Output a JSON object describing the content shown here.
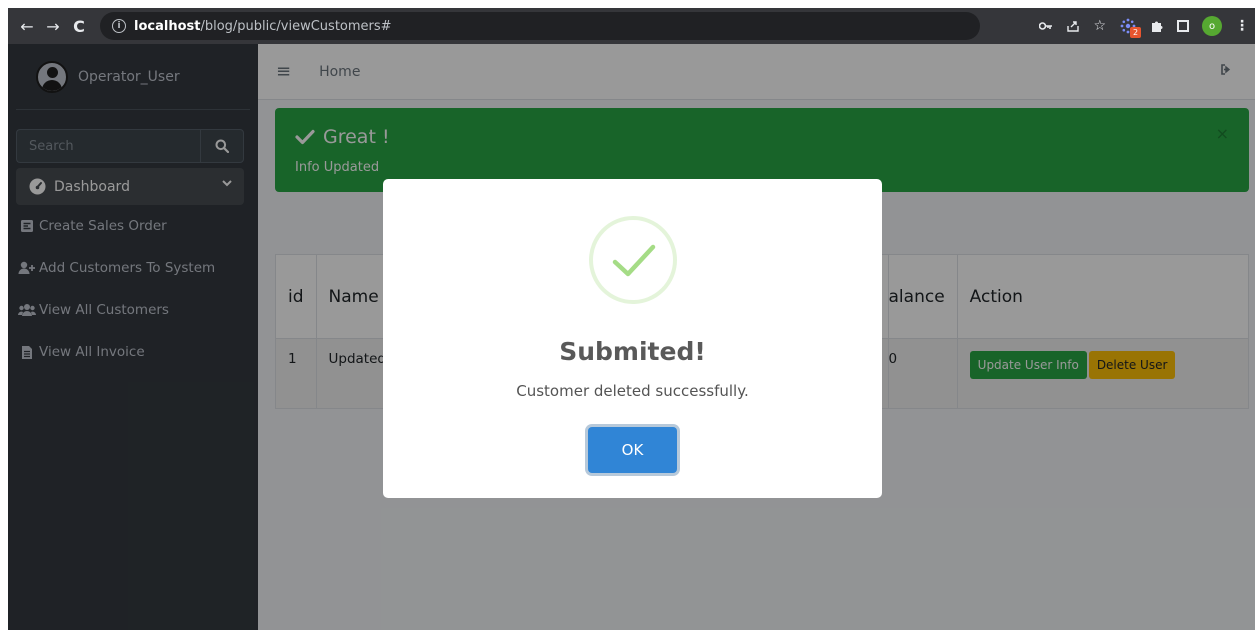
{
  "browser": {
    "url_host": "localhost",
    "url_path": "/blog/public/viewCustomers#",
    "extension_badge": "2",
    "profile_initial": "o"
  },
  "sidebar": {
    "user_name": "Operator_User",
    "search_placeholder": "Search",
    "dashboard_label": "Dashboard",
    "items": [
      {
        "label": "Create Sales Order",
        "icon": "receipt-icon"
      },
      {
        "label": "Add Customers To System",
        "icon": "user-plus-icon"
      },
      {
        "label": "View All Customers",
        "icon": "users-icon"
      },
      {
        "label": "View All Invoice",
        "icon": "file-icon"
      }
    ]
  },
  "topbar": {
    "home_label": "Home"
  },
  "alert": {
    "title": "Great !",
    "message": "Info Updated",
    "close": "×",
    "color": "#28a745"
  },
  "table": {
    "headers": {
      "id": "id",
      "name": "Name",
      "balance": "alance",
      "action": "Action"
    },
    "rows": [
      {
        "id": "1",
        "name": "Updated_",
        "balance": "0",
        "update_label": "Update User Info",
        "delete_label": "Delete User"
      }
    ]
  },
  "modal": {
    "title": "Submited!",
    "text": "Customer deleted successfully.",
    "ok_label": "OK",
    "icon": "success-check-icon",
    "accent": "#3085d6"
  }
}
